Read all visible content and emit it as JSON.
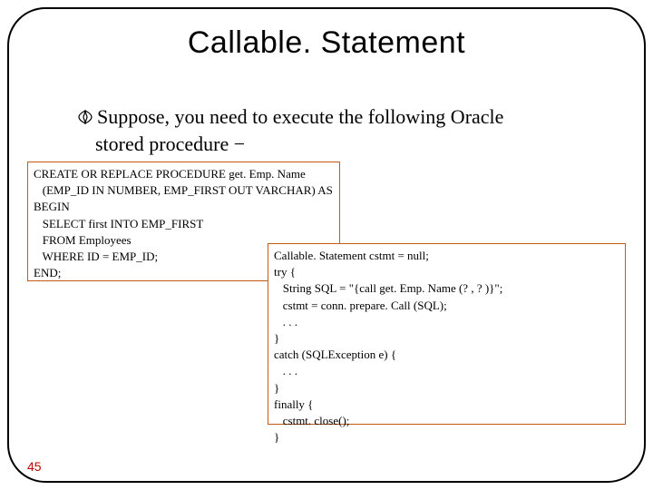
{
  "title": "Callable. Statement",
  "body": {
    "line1": "Suppose, you need to execute the following Oracle",
    "line2": "stored procedure −"
  },
  "code_left": "CREATE OR REPLACE PROCEDURE get. Emp. Name\n   (EMP_ID IN NUMBER, EMP_FIRST OUT VARCHAR) AS\nBEGIN\n   SELECT first INTO EMP_FIRST\n   FROM Employees\n   WHERE ID = EMP_ID;\nEND;",
  "code_right": "Callable. Statement cstmt = null;\ntry {\n   String SQL = \"{call get. Emp. Name (? , ? )}\";\n   cstmt = conn. prepare. Call (SQL);\n   . . .\n}\ncatch (SQLException e) {\n   . . .\n}\nfinally {\n   cstmt. close();\n}",
  "page_number": "45"
}
